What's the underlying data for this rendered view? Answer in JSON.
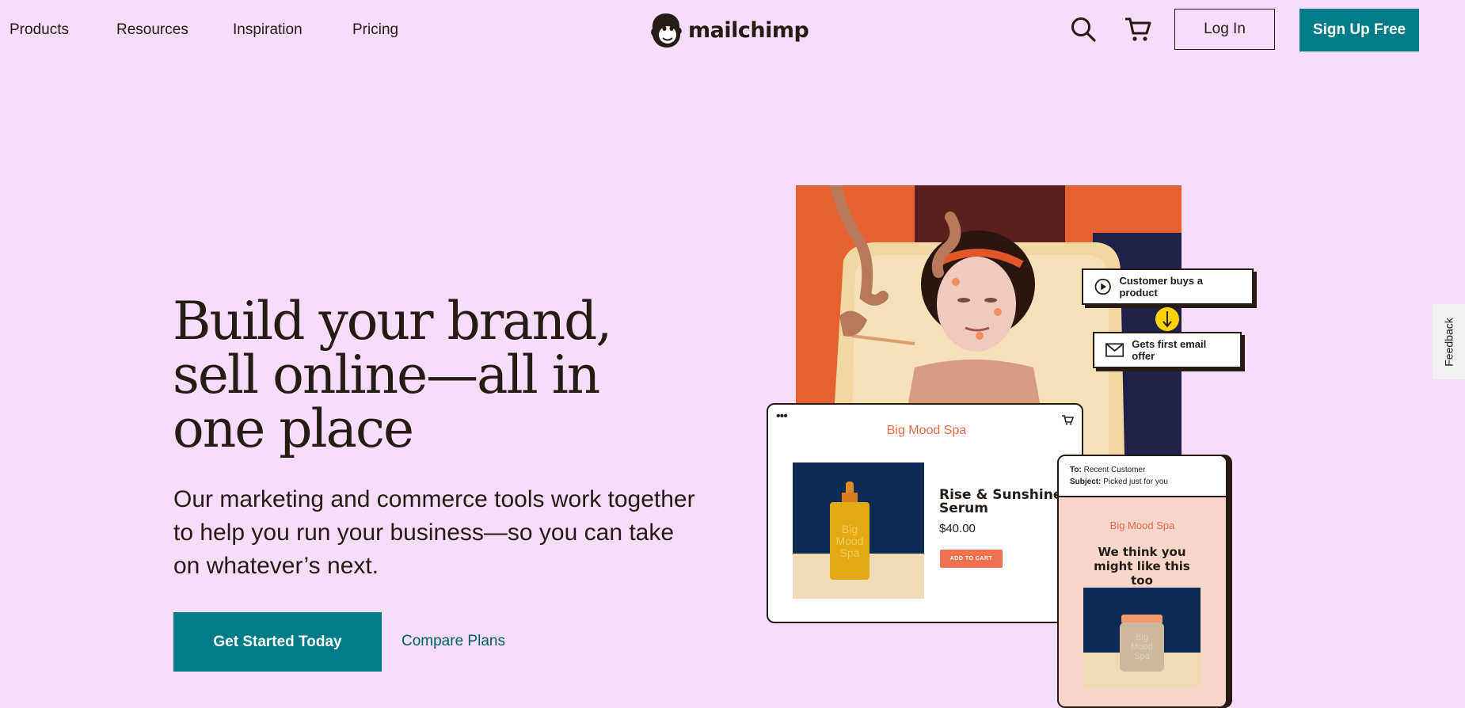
{
  "nav": {
    "items": [
      {
        "label": "Products"
      },
      {
        "label": "Resources"
      },
      {
        "label": "Inspiration"
      },
      {
        "label": "Pricing"
      }
    ],
    "logo_text": "mailchimp",
    "login_label": "Log In",
    "signup_label": "Sign Up Free"
  },
  "hero": {
    "headline": "Build your brand, sell online—all in one place",
    "subtext": "Our marketing and commerce tools work together to help you run your business—so you can take on whatever’s next.",
    "cta_label": "Get Started Today",
    "compare_label": "Compare Plans"
  },
  "illustration": {
    "flow_step_1": "Customer buys a product",
    "flow_step_2": "Gets first email offer",
    "shop": {
      "store_name": "Big Mood Spa",
      "product_name": "Rise & Sunshine Serum",
      "price": "$40.00",
      "add_to_cart": "ADD TO CART",
      "bottle_label": "Big Mood Spa"
    },
    "email": {
      "to_label": "To:",
      "to_value": "Recent Customer",
      "subject_label": "Subject:",
      "subject_value": "Picked just for you",
      "brand": "Big Mood Spa",
      "headline": "We think you might like this too",
      "jar_label": "Big Mood Spa"
    }
  },
  "feedback_label": "Feedback",
  "colors": {
    "background": "#f6ddf9",
    "accent_teal": "#007c89",
    "brand_coral": "#e86a47",
    "text": "#241c15"
  }
}
